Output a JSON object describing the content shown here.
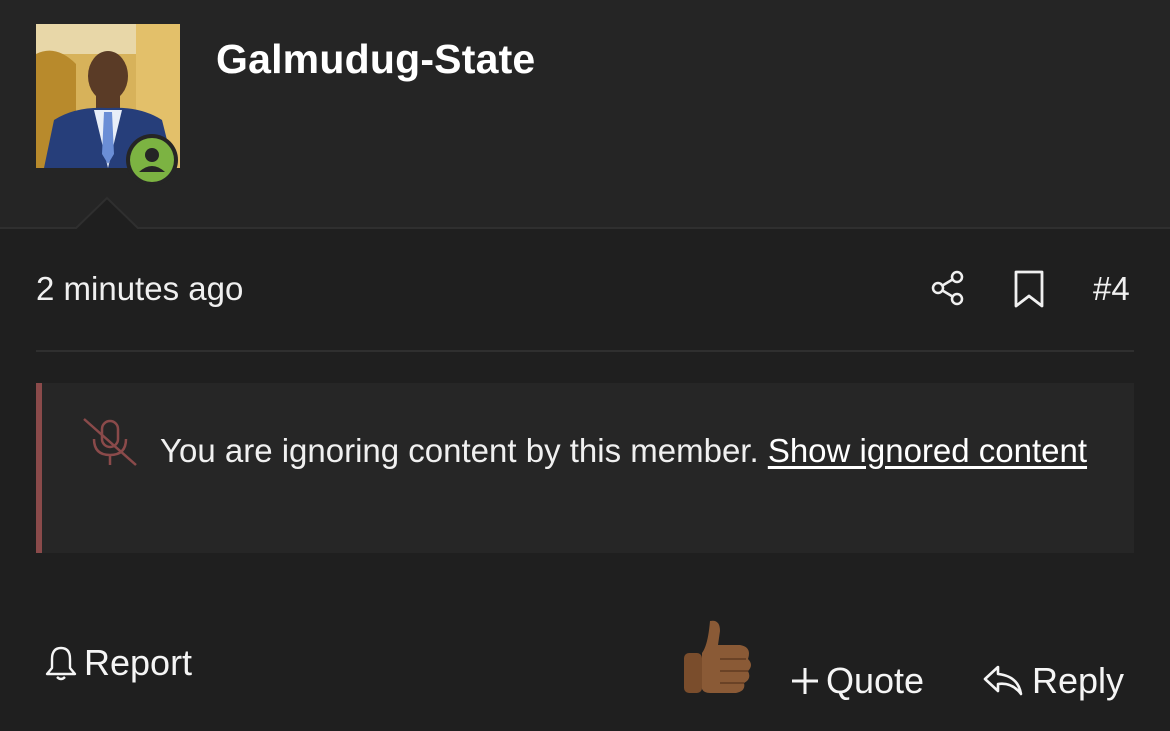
{
  "header": {
    "username": "Galmudug-State",
    "avatar_icon": "member-avatar-photo",
    "status_icon": "online-user-icon",
    "status_color": "#7cb342"
  },
  "post": {
    "timestamp": "2 minutes ago",
    "post_number": "#4",
    "share_icon": "share-icon",
    "bookmark_icon": "bookmark-icon"
  },
  "ignored_notice": {
    "icon": "muted-microphone-icon",
    "text": "You are ignoring content by this member.",
    "link_label": "Show ignored content",
    "accent_color": "#8a4a4a"
  },
  "actions": {
    "report_label": "Report",
    "quote_label": "Quote",
    "reply_label": "Reply",
    "like_icon": "thumbs-up-emoji"
  }
}
